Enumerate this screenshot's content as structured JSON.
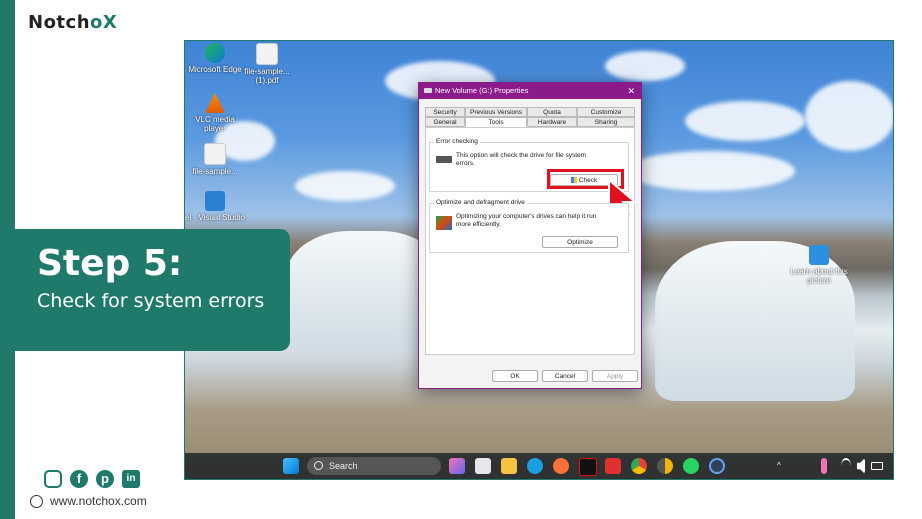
{
  "brand": {
    "prefix": "Notch",
    "mid": "o",
    "suffix": "X"
  },
  "desktop": {
    "icons": [
      {
        "label": "Microsoft Edge"
      },
      {
        "label": "file-sample... (1).pdf"
      },
      {
        "label": "VLC media player"
      },
      {
        "label": "file-sample..."
      },
      {
        "label": "el - Visual Studio"
      },
      {
        "label": "Learn about this picture"
      }
    ],
    "search_placeholder": "Search"
  },
  "dialog": {
    "title": "New Volume (G:) Properties",
    "close": "✕",
    "tabs_row1": [
      "Security",
      "Previous Versions",
      "Quota",
      "Customize"
    ],
    "tabs_row2": [
      "General",
      "Tools",
      "Hardware",
      "Sharing"
    ],
    "active_tab": "Tools",
    "error_group_title": "Error checking",
    "error_text": "This option will check the drive for file system errors.",
    "check_label": "Check",
    "optimize_group_title": "Optimize and defragment drive",
    "optimize_text": "Optimizing your computer's drives can help it run more efficiently.",
    "optimize_label": "Optimize",
    "ok_label": "OK",
    "cancel_label": "Cancel",
    "apply_label": "Apply"
  },
  "step": {
    "title": "Step 5:",
    "subtitle": "Check for system errors"
  },
  "footer": {
    "website": "www.notchox.com",
    "social": [
      "instagram-icon",
      "facebook-icon",
      "pinterest-icon",
      "linkedin-icon"
    ]
  },
  "colors": {
    "brand": "#1f7a6b",
    "title_bar": "#8b1a8b",
    "highlight": "#e0101f"
  }
}
